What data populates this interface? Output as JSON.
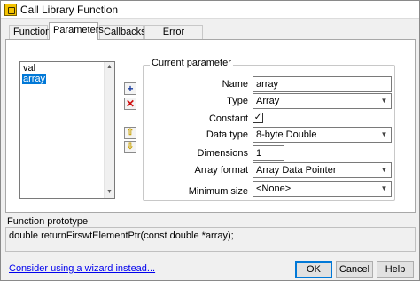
{
  "window": {
    "title": "Call Library Function",
    "icon": "call-library-node-icon"
  },
  "tabs": [
    {
      "label": "Function",
      "active": false
    },
    {
      "label": "Parameters",
      "active": true
    },
    {
      "label": "Callbacks",
      "active": false
    },
    {
      "label": "Error Checking",
      "active": false
    }
  ],
  "parameters_list": {
    "items": [
      {
        "label": "val",
        "selected": false
      },
      {
        "label": "array",
        "selected": true
      }
    ]
  },
  "side_buttons": {
    "add": "add-parameter-icon",
    "remove": "remove-parameter-icon",
    "move_up": "move-up-icon",
    "move_down": "move-down-icon"
  },
  "current_parameter": {
    "group_title": "Current parameter",
    "name": {
      "label": "Name",
      "value": "array"
    },
    "type": {
      "label": "Type",
      "value": "Array"
    },
    "constant": {
      "label": "Constant",
      "checked": true,
      "glyph": "✓"
    },
    "data_type": {
      "label": "Data type",
      "value": "8-byte Double"
    },
    "dimensions": {
      "label": "Dimensions",
      "value": "1"
    },
    "array_format": {
      "label": "Array format",
      "value": "Array Data Pointer"
    },
    "minimum_size": {
      "label": "Minimum size",
      "value": "<None>"
    }
  },
  "function_prototype": {
    "label": "Function prototype",
    "text": "double returnFirswtElementPtr(const double *array);"
  },
  "footer": {
    "wizard_link": "Consider using a wizard instead...",
    "ok": "OK",
    "cancel": "Cancel",
    "help": "Help"
  },
  "colors": {
    "selection": "#0078d7",
    "link": "#0000ee",
    "default_button_border": "#0078d7"
  }
}
